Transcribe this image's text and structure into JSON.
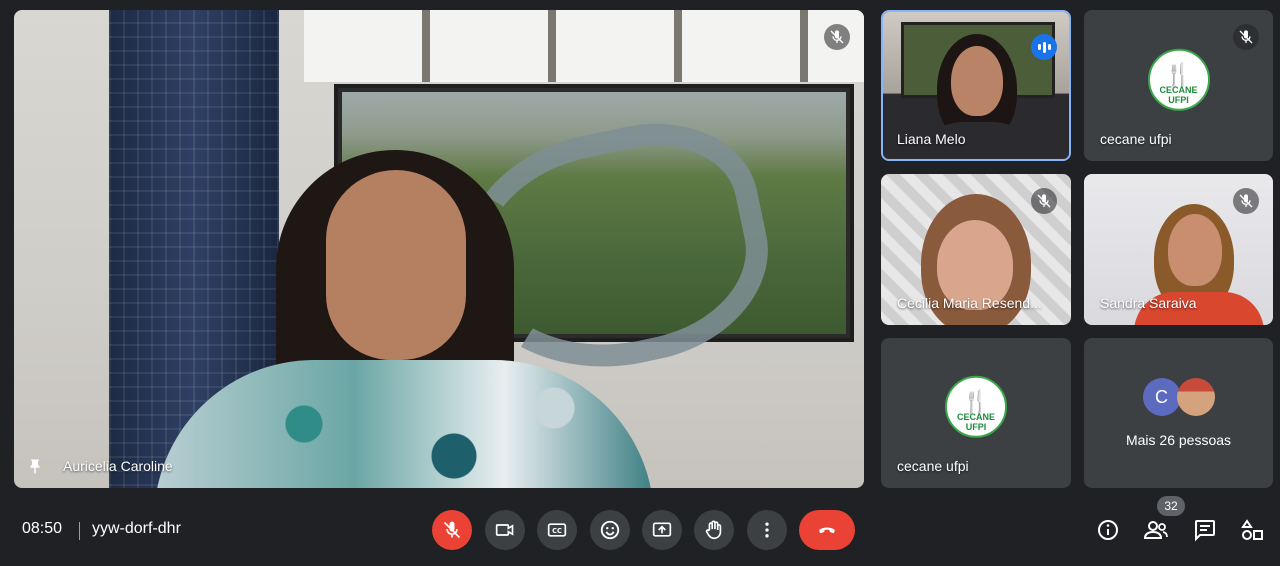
{
  "main_tile": {
    "participant_name": "Auricelia Caroline"
  },
  "thumbnails": [
    {
      "name": "Liana Melo"
    },
    {
      "name": "cecane ufpi",
      "logo_text": "CECANE UFPI"
    },
    {
      "name": "Cecilia Maria Resend..."
    },
    {
      "name": "Sandra Saraiva"
    },
    {
      "name": "cecane ufpi",
      "logo_text": "CECANE UFPI"
    }
  ],
  "more_tile": {
    "avatar_initial": "C",
    "label": "Mais 26 pessoas"
  },
  "bottom_bar": {
    "time": "08:50",
    "meeting_code": "yyw-dorf-dhr",
    "people_count": "32"
  },
  "icons": {
    "pin": "pin-icon",
    "mic_off": "mic-off-icon",
    "camera": "camera-icon",
    "captions": "captions-icon",
    "emoji": "emoji-icon",
    "present": "present-icon",
    "raise_hand": "raise-hand-icon",
    "more": "more-options-icon",
    "hangup": "hang-up-icon",
    "info": "info-icon",
    "people": "people-icon",
    "chat": "chat-icon",
    "activities": "activities-icon"
  },
  "colors": {
    "background": "#202124",
    "tile": "#3c4043",
    "danger": "#ea4335",
    "speaking": "#1a73e8"
  }
}
